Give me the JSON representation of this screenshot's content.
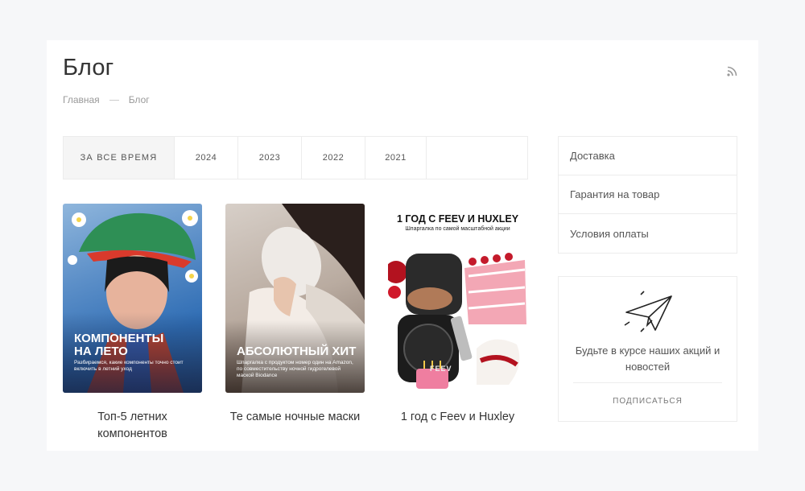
{
  "page": {
    "title": "Блог",
    "breadcrumb": [
      "Главная",
      "Блог"
    ]
  },
  "tabs": [
    "ЗА ВСЕ ВРЕМЯ",
    "2024",
    "2023",
    "2022",
    "2021"
  ],
  "posts": [
    {
      "title": "Топ-5 летних компонентов",
      "image_heading": "КОМПОНЕНТЫ НА ЛЕТО",
      "image_caption": "Разбираемся, какие компоненты точно стоит включить в летний уход"
    },
    {
      "title": "Те самые ночные маски",
      "image_heading": "АБСОЛЮТНЫЙ ХИТ",
      "image_caption": "Шпаргалка с продуктом номер один на Amazon, по совместительству ночной гидрогелевой маской Biodance"
    },
    {
      "title": "1 год с Feev и Huxley",
      "image_heading": "1 ГОД С FEEV И HUXLEY",
      "image_caption": "Шпаргалка по самой масштабной акции",
      "image_brand": "FEEV"
    }
  ],
  "sidebar": {
    "menu": [
      "Доставка",
      "Гарантия на товар",
      "Условия оплаты"
    ],
    "subscribe": {
      "text": "Будьте в курсе наших акций и новостей",
      "button": "ПОДПИСАТЬСЯ"
    }
  },
  "icons": [
    "rss-icon",
    "paper-plane-icon"
  ],
  "colors": {
    "background": "#f6f7f9",
    "card": "#ffffff",
    "border": "#ececec",
    "text": "#333333",
    "muted": "#999999"
  }
}
